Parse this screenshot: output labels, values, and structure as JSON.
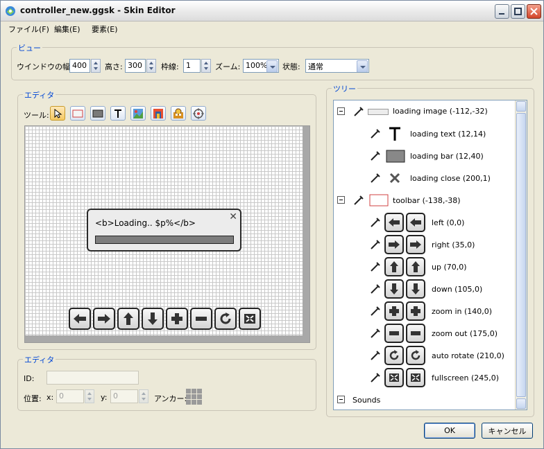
{
  "window": {
    "title": "controller_new.ggsk - Skin Editor"
  },
  "menu": [
    "ファイル(F)",
    "編集(E)",
    "要素(E)"
  ],
  "view": {
    "group_label": "ビュー",
    "width_label": "ウインドウの幅:",
    "width_value": "400",
    "height_label": "高さ:",
    "height_value": "300",
    "border_label": "枠線:",
    "border_value": "1",
    "zoom_label": "ズーム:",
    "zoom_value": "100%",
    "state_label": "状態:",
    "state_value": "通常"
  },
  "editor": {
    "group_label": "エディタ",
    "tools_label": "ツール:",
    "tools": [
      "cursor-icon",
      "rectangle-icon",
      "filled-rectangle-icon",
      "text-icon",
      "image-icon",
      "button-icon",
      "cloner-icon",
      "target-icon"
    ],
    "loading_text": "<b>Loading.. $p%</b>",
    "loading_close": "✕"
  },
  "properties": {
    "group_label": "エディタ",
    "id_label": "ID:",
    "id_value": "",
    "position_label": "位置:",
    "x_label": "x:",
    "x_value": "0",
    "y_label": "y:",
    "y_value": "0",
    "anchor_label": "アンカー:"
  },
  "tree": {
    "group_label": "ツリー",
    "items": [
      {
        "label": "loading image (-112,-32)",
        "level": 0
      },
      {
        "label": "loading text (12,14)",
        "level": 1
      },
      {
        "label": "loading bar (12,40)",
        "level": 1
      },
      {
        "label": "loading close (200,1)",
        "level": 1
      },
      {
        "label": "toolbar (-138,-38)",
        "level": 0
      },
      {
        "label": "left (0,0)",
        "level": 1
      },
      {
        "label": "right (35,0)",
        "level": 1
      },
      {
        "label": "up (70,0)",
        "level": 1
      },
      {
        "label": "down (105,0)",
        "level": 1
      },
      {
        "label": "zoom in (140,0)",
        "level": 1
      },
      {
        "label": "zoom out (175,0)",
        "level": 1
      },
      {
        "label": "auto rotate (210,0)",
        "level": 1
      },
      {
        "label": "fullscreen (245,0)",
        "level": 1
      },
      {
        "label": "Sounds",
        "level": 0
      }
    ]
  },
  "buttons": {
    "ok": "OK",
    "cancel": "キャンセル"
  },
  "colors": {
    "group_label": "#0046d5",
    "window_bg": "#ece9d8"
  }
}
